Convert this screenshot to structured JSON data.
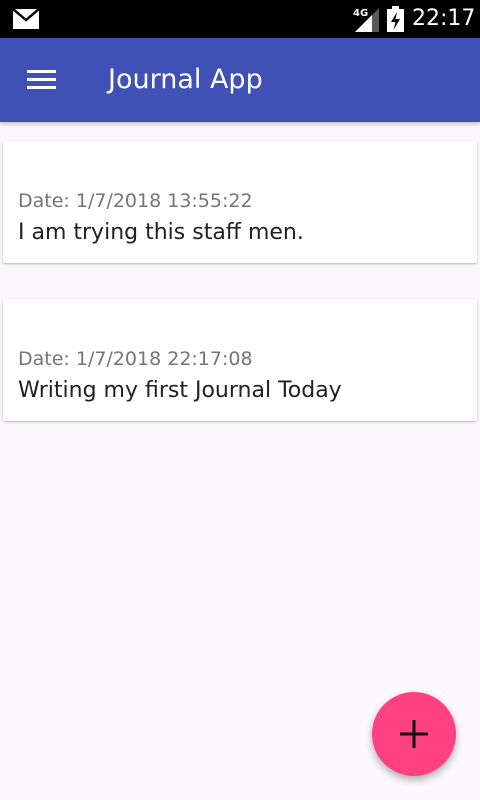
{
  "status_bar": {
    "time": "22:17",
    "network_label": "4G",
    "icons": [
      "mail-icon",
      "signal-4g-icon",
      "battery-charging-icon"
    ]
  },
  "app_bar": {
    "title": "Journal App",
    "menu_icon": "menu-icon",
    "color": "#3f51b5"
  },
  "entries": [
    {
      "date": "Date: 1/7/2018 13:55:22",
      "text": "I am trying this staff men."
    },
    {
      "date": "Date: 1/7/2018 22:17:08",
      "text": "Writing my first Journal Today"
    }
  ],
  "fab": {
    "icon": "plus-icon",
    "color": "#ff4081"
  }
}
